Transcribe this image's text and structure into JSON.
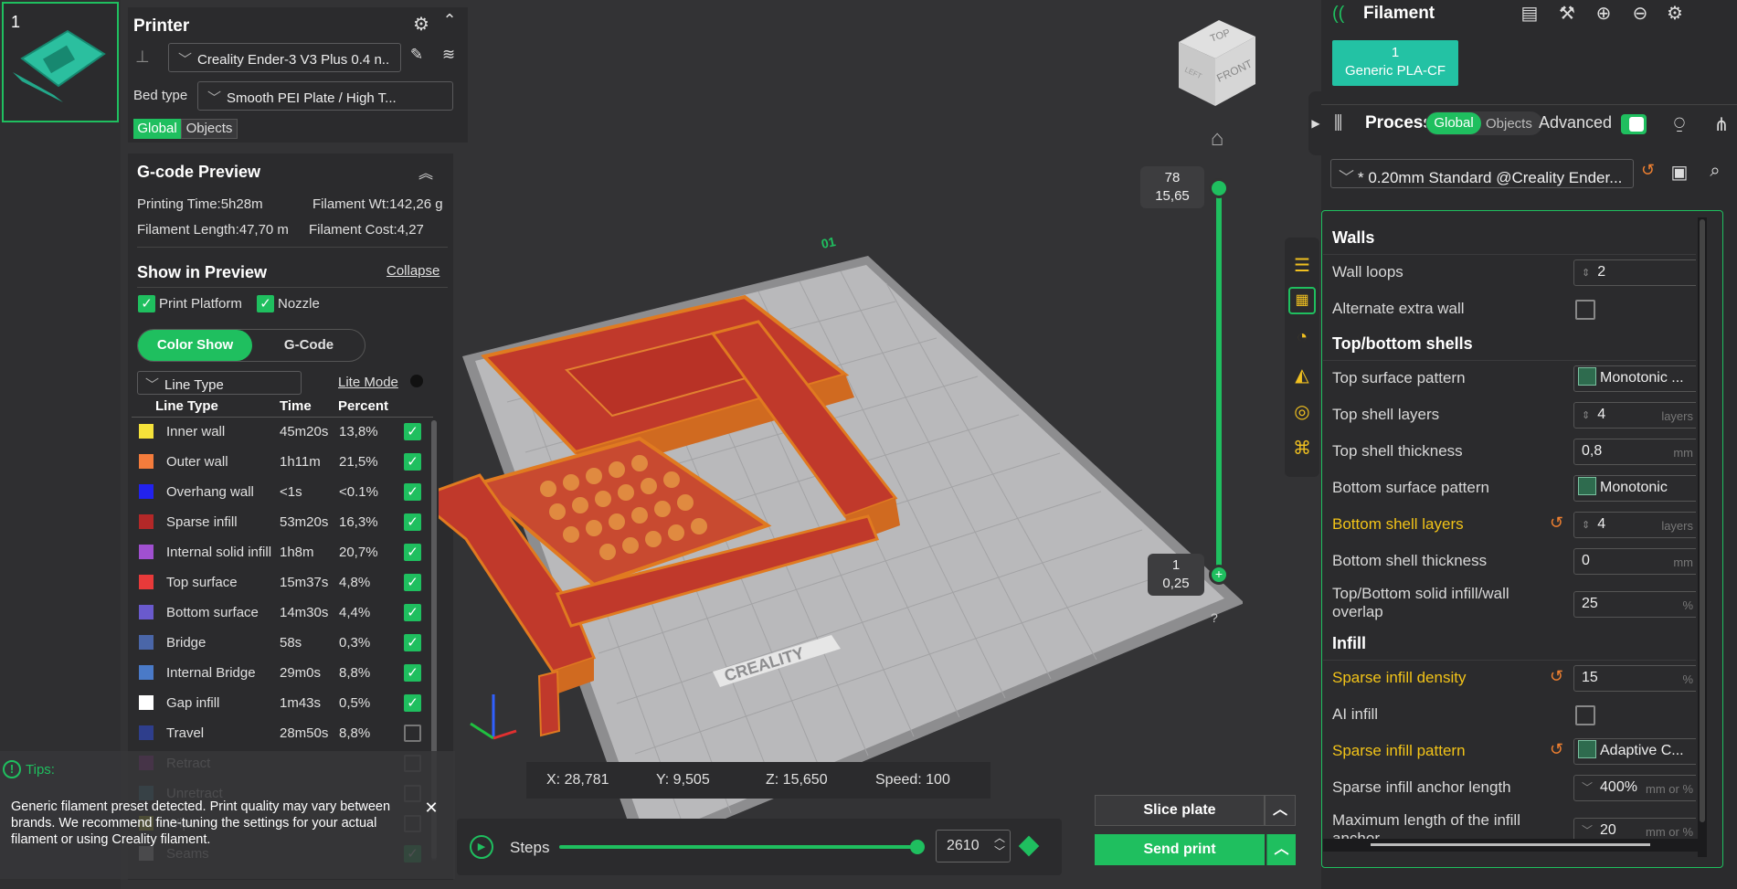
{
  "plate": {
    "number": "1"
  },
  "printer": {
    "title": "Printer",
    "preset": "Creality Ender-3 V3 Plus 0.4 n..",
    "bed_type_label": "Bed type",
    "bed_type": "Smooth PEI Plate / High T...",
    "tabs": [
      "Global",
      "Objects"
    ]
  },
  "gcode": {
    "title": "G-code Preview",
    "printing_time": "Printing Time:5h28m",
    "filament_wt": "Filament Wt:142,26 g",
    "filament_length": "Filament Length:47,70 m",
    "filament_cost": "Filament Cost:4,27",
    "show_title": "Show in Preview",
    "collapse": "Collapse",
    "print_platform": "Print Platform",
    "nozzle": "Nozzle",
    "view_tabs": [
      "Color Show",
      "G-Code"
    ],
    "line_type_select": "Line Type",
    "lite_mode": "Lite Mode",
    "columns": [
      "Line Type",
      "Time",
      "Percent"
    ],
    "rows": [
      {
        "name": "Inner wall",
        "time": "45m20s",
        "pct": "13,8%",
        "color": "#f5e23a",
        "checked": true
      },
      {
        "name": "Outer wall",
        "time": "1h11m",
        "pct": "21,5%",
        "color": "#f47c3c",
        "checked": true
      },
      {
        "name": "Overhang wall",
        "time": "<1s",
        "pct": "<0.1%",
        "color": "#2222ee",
        "checked": true
      },
      {
        "name": "Sparse infill",
        "time": "53m20s",
        "pct": "16,3%",
        "color": "#b32828",
        "checked": true
      },
      {
        "name": "Internal solid infill",
        "time": "1h8m",
        "pct": "20,7%",
        "color": "#a050d0",
        "checked": true
      },
      {
        "name": "Top surface",
        "time": "15m37s",
        "pct": "4,8%",
        "color": "#e83a3a",
        "checked": true
      },
      {
        "name": "Bottom surface",
        "time": "14m30s",
        "pct": "4,4%",
        "color": "#6a5acd",
        "checked": true
      },
      {
        "name": "Bridge",
        "time": "58s",
        "pct": "0,3%",
        "color": "#4a66a8",
        "checked": true
      },
      {
        "name": "Internal Bridge",
        "time": "29m0s",
        "pct": "8,8%",
        "color": "#4a7ac8",
        "checked": true
      },
      {
        "name": "Gap infill",
        "time": "1m43s",
        "pct": "0,5%",
        "color": "#ffffff",
        "checked": true
      },
      {
        "name": "Travel",
        "time": "28m50s",
        "pct": "8,8%",
        "color": "#2e3e8c",
        "checked": false
      },
      {
        "name": "Retract",
        "time": "",
        "pct": "",
        "color": "#b020b0",
        "checked": false
      },
      {
        "name": "Unretract",
        "time": "",
        "pct": "",
        "color": "#3a8aa0",
        "checked": false
      },
      {
        "name": "Wipe",
        "time": "",
        "pct": "",
        "color": "#e8e820",
        "checked": false
      },
      {
        "name": "Seams",
        "time": "",
        "pct": "",
        "color": "#d0d0d0",
        "checked": true
      }
    ]
  },
  "tips": {
    "title": "Tips:",
    "text": "Generic filament preset detected. Print quality may vary between brands. We recommend fine-tuning the settings for your actual filament or using Creality filament."
  },
  "viewport": {
    "cube_top": "TOP",
    "cube_front": "FRONT",
    "cube_left": "LEFT",
    "layer_top": "78",
    "layer_top_h": "15,65",
    "layer_bottom": "1",
    "layer_bottom_h": "0,25",
    "plate_name": "CREALITY",
    "plate_badge": "01",
    "question": "?",
    "coords": {
      "x": "X: 28,781",
      "y": "Y: 9,505",
      "z": "Z: 15,650",
      "speed": "Speed: 100"
    },
    "steps_label": "Steps",
    "steps_value": "2610",
    "steps_fraction": 0.985
  },
  "actions": {
    "slice": "Slice plate",
    "send": "Send print"
  },
  "filament": {
    "title": "Filament",
    "slot_number": "1",
    "slot_name": "Generic PLA-CF",
    "slot_color": "#23c2a4"
  },
  "process": {
    "title": "Process",
    "tabs": [
      "Global",
      "Objects"
    ],
    "advanced": "Advanced",
    "preset": "* 0.20mm Standard @Creality Ender...",
    "settings": [
      {
        "type": "section",
        "label": "Walls"
      },
      {
        "type": "spin",
        "label": "Wall loops",
        "value": "2",
        "unit": ""
      },
      {
        "type": "check",
        "label": "Alternate extra wall"
      },
      {
        "type": "section",
        "label": "Top/bottom shells"
      },
      {
        "type": "pattern",
        "label": "Top surface pattern",
        "value": "Monotonic ..."
      },
      {
        "type": "spin",
        "label": "Top shell layers",
        "value": "4",
        "unit": "layers"
      },
      {
        "type": "text",
        "label": "Top shell thickness",
        "value": "0,8",
        "unit": "mm"
      },
      {
        "type": "pattern",
        "label": "Bottom surface pattern",
        "value": "Monotonic"
      },
      {
        "type": "spin",
        "label": "Bottom shell layers",
        "value": "4",
        "unit": "layers",
        "modified": true
      },
      {
        "type": "text",
        "label": "Bottom shell thickness",
        "value": "0",
        "unit": "mm"
      },
      {
        "type": "text",
        "label": "Top/Bottom solid infill/wall overlap",
        "value": "25",
        "unit": "%",
        "tall": true
      },
      {
        "type": "section",
        "label": "Infill"
      },
      {
        "type": "text",
        "label": "Sparse infill density",
        "value": "15",
        "unit": "%",
        "modified": true
      },
      {
        "type": "check",
        "label": "AI infill"
      },
      {
        "type": "pattern",
        "label": "Sparse infill pattern",
        "value": "Adaptive C...",
        "modified": true
      },
      {
        "type": "combo",
        "label": "Sparse infill anchor length",
        "value": "400%",
        "unit": "mm or %"
      },
      {
        "type": "combo",
        "label": "Maximum length of the infill anchor",
        "value": "20",
        "unit": "mm or %",
        "tall": true
      }
    ]
  }
}
